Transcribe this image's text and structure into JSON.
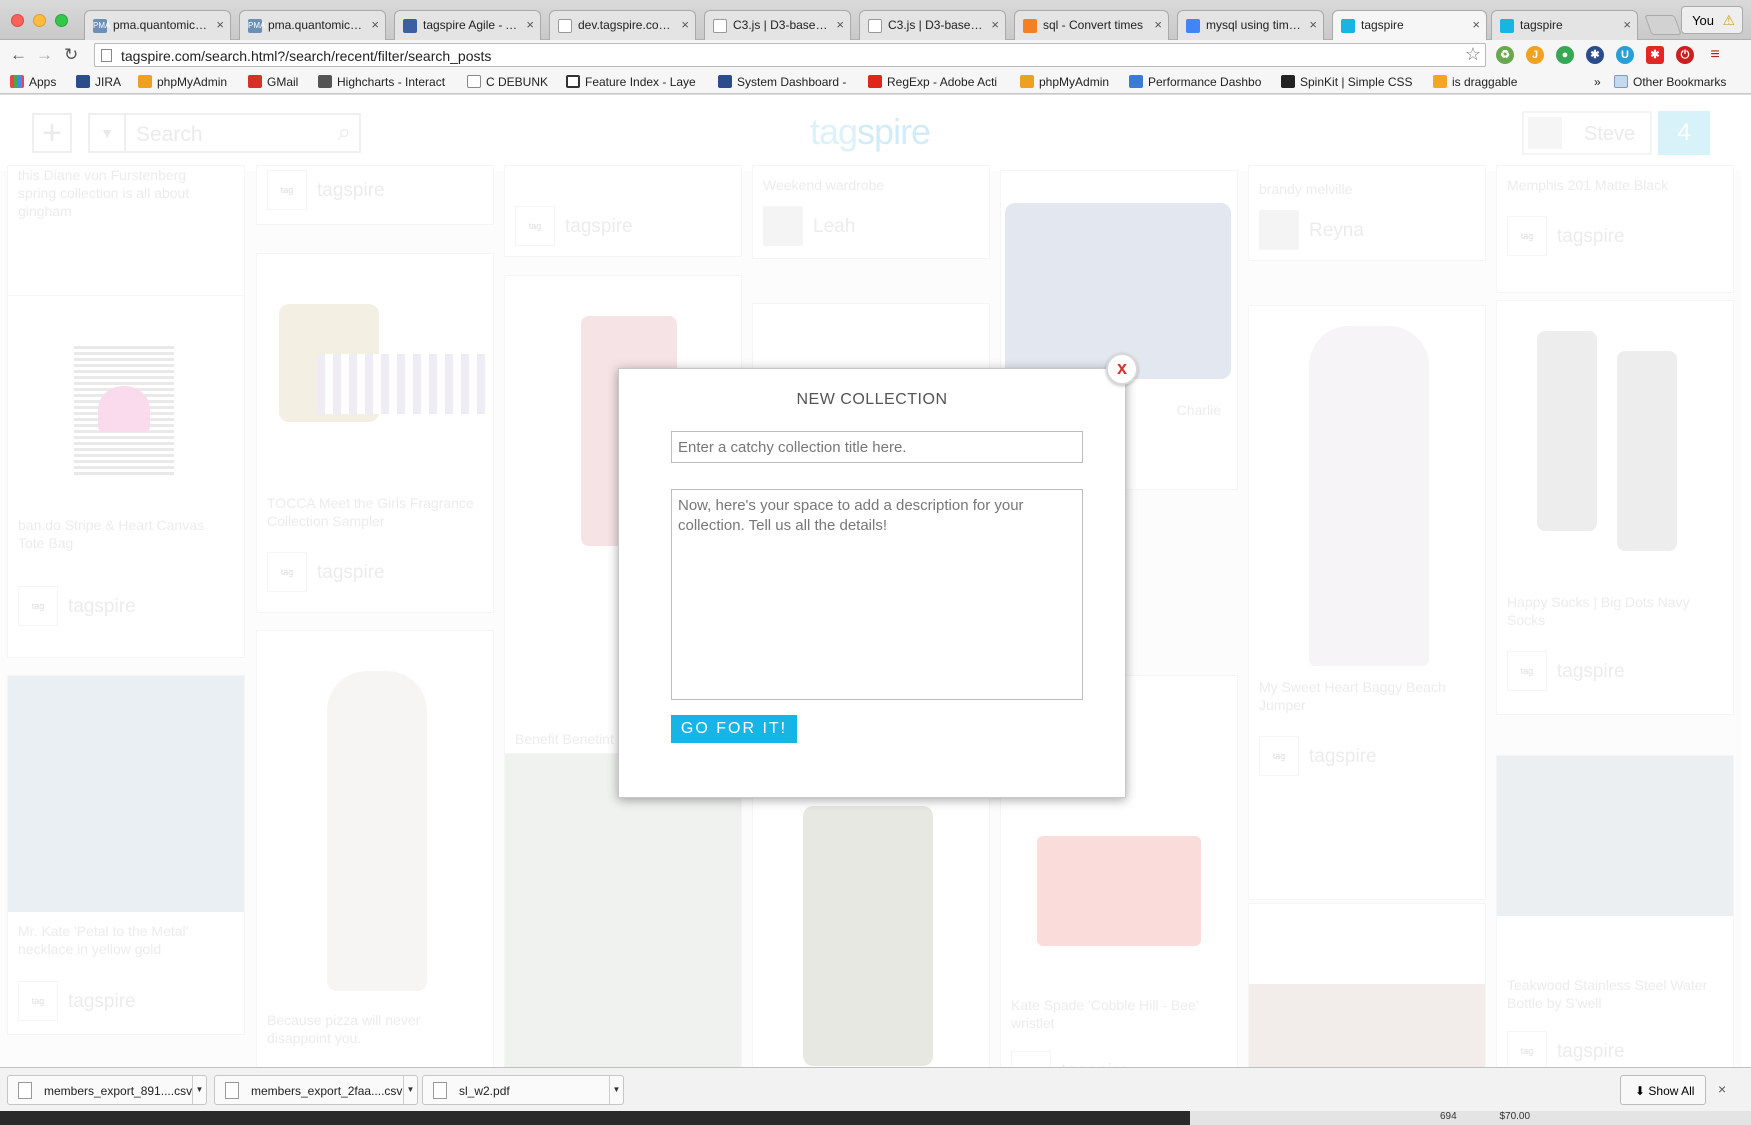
{
  "browser": {
    "tabs": [
      {
        "label": "pma.quantomic.com",
        "favicon": "PMA"
      },
      {
        "label": "pma.quantomic.com",
        "favicon": "PMA"
      },
      {
        "label": "tagspire Agile - Agile",
        "favicon": "jira"
      },
      {
        "label": "dev.tagspire.com/a",
        "favicon": "page"
      },
      {
        "label": "C3.js | D3-based re",
        "favicon": "page"
      },
      {
        "label": "C3.js | D3-based re",
        "favicon": "page"
      },
      {
        "label": "sql - Convert times",
        "favicon": "so"
      },
      {
        "label": "mysql using time st",
        "favicon": "g"
      },
      {
        "label": "tagspire",
        "favicon": "tag"
      },
      {
        "label": "tagspire",
        "favicon": "tag"
      }
    ],
    "profile_label": "You",
    "url": "tagspire.com/search.html?/search/recent/filter/search_posts",
    "bookmarks": [
      "Apps",
      "JIRA",
      "phpMyAdmin",
      "GMail",
      "Highcharts - Interact",
      "C DEBUNK",
      "Feature Index - Laye",
      "System Dashboard -",
      "RegExp - Adobe Acti",
      "phpMyAdmin",
      "Performance Dashbo",
      "SpinKit | Simple CSS",
      "is draggable"
    ],
    "bookmarks_overflow": "»",
    "other_bookmarks": "Other Bookmarks"
  },
  "site": {
    "search_placeholder": "Search",
    "logo_tag": "tag",
    "logo_spire": "spire",
    "user_name": "Steve",
    "notification_count": "4",
    "tag_label": "tagspire",
    "cards": {
      "c1_title": "this Diane von Furstenberg spring collection is all about gingham",
      "c2_title": "ban.do Stripe & Heart Canvas Tote Bag",
      "c3_title": "Mr. Kate 'Petal to the Metal' necklace in yellow gold",
      "c4_title": "TOCCA Meet the Girls Fragrance Collection Sampler",
      "c5_title": "Because pizza will never disappoint you.",
      "c6_title": "Benefit Benetint lip",
      "c7_title": "Weekend wardrobe",
      "c7_user": "Leah",
      "c8_title": "Charlie",
      "c9_title": "Kate Spade 'Cobble Hill - Bee' wristlet",
      "c10_title": "brandy melville",
      "c10_user": "Reyna",
      "c11_title": "My Sweet Heart Baggy Beach Jumper",
      "c12_title": "Memphis 201 Matte Black",
      "c13_title": "Happy Socks | Big Dots Navy Socks",
      "c14_title": "Teakwood Stainless Steel Water Bottle by S'well"
    }
  },
  "modal": {
    "title": "NEW COLLECTION",
    "close_label": "x",
    "title_placeholder": "Enter a catchy collection title here.",
    "description_placeholder": "Now, here's your space to add a description for your collection. Tell us all the details!",
    "submit_label": "GO FOR IT!"
  },
  "downloads": {
    "items": [
      {
        "name": "members_export_891....csv"
      },
      {
        "name": "members_export_2faa....csv"
      },
      {
        "name": "sl_w2.pdf"
      }
    ],
    "show_all": "Show All",
    "close": "×"
  },
  "background_snippets": {
    "left_value": "694",
    "right_value": "$70.00"
  },
  "colors": {
    "accent": "#17b5e5",
    "close_x": "#d3352b"
  }
}
